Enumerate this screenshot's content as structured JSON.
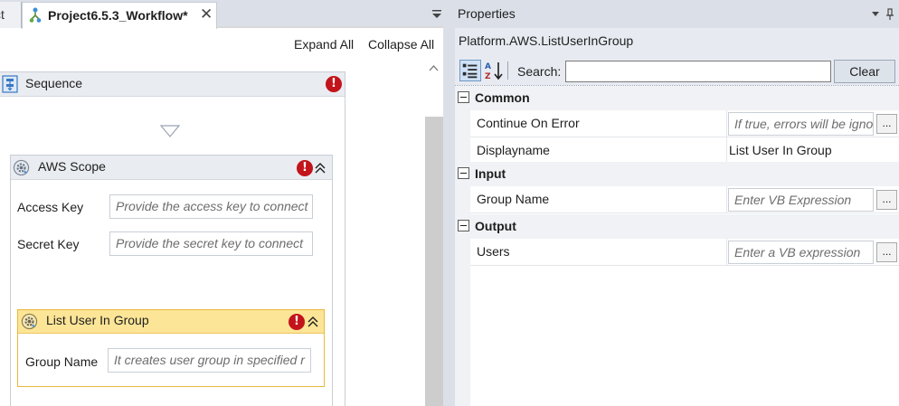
{
  "designer": {
    "prev_tab_label": "ct",
    "active_tab_label": "Project6.5.3_Workflow*",
    "expand_all": "Expand All",
    "collapse_all": "Collapse All",
    "sequence": {
      "title": "Sequence"
    },
    "aws_scope": {
      "title": "AWS Scope",
      "fields": {
        "access_key_label": "Access Key",
        "access_key_placeholder": "Provide the access key to connect",
        "secret_key_label": "Secret Key",
        "secret_key_placeholder": "Provide the secret key to connect"
      }
    },
    "list_user_in_group": {
      "title": "List User In Group",
      "group_name_label": "Group Name",
      "group_name_placeholder": "It creates user group in specified r"
    },
    "colors": {
      "error": "#c3131b",
      "activity_selected_header": "#fde597",
      "activity_header": "#e9ecf0"
    }
  },
  "properties": {
    "title": "Properties",
    "type_name": "Platform.AWS.ListUserInGroup",
    "search_label": "Search:",
    "search_value": "",
    "clear_label": "Clear",
    "ellipsis_label": "...",
    "categories": [
      {
        "name": "Common",
        "rows": [
          {
            "name": "Continue On Error",
            "placeholder": "If true, errors will be ignored"
          },
          {
            "name": "Displayname",
            "value": "List User In Group"
          }
        ]
      },
      {
        "name": "Input",
        "rows": [
          {
            "name": "Group Name",
            "placeholder": "Enter VB Expression"
          }
        ]
      },
      {
        "name": "Output",
        "rows": [
          {
            "name": "Users",
            "placeholder": "Enter a VB expression"
          }
        ]
      }
    ]
  }
}
